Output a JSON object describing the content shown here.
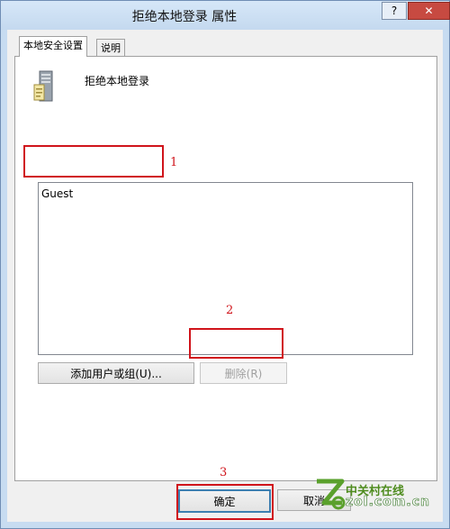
{
  "window": {
    "title": "拒绝本地登录 属性",
    "help_label": "?",
    "close_label": "✕"
  },
  "tabs": [
    {
      "label": "本地安全设置",
      "active": true
    },
    {
      "label": "说明",
      "active": false
    }
  ],
  "policy": {
    "name": "拒绝本地登录",
    "icon": "server-policy-icon"
  },
  "list": {
    "items": [
      "Guest"
    ]
  },
  "buttons": {
    "add": "添加用户或组(U)...",
    "remove": "删除(R)",
    "ok": "确定",
    "cancel": "取消"
  },
  "annotations": {
    "marker1": "1",
    "marker2": "2",
    "marker3": "3",
    "highlight_color": "#d0141b"
  },
  "watermark": {
    "cn": "中关村在线",
    "en": "zol.com.cn"
  }
}
